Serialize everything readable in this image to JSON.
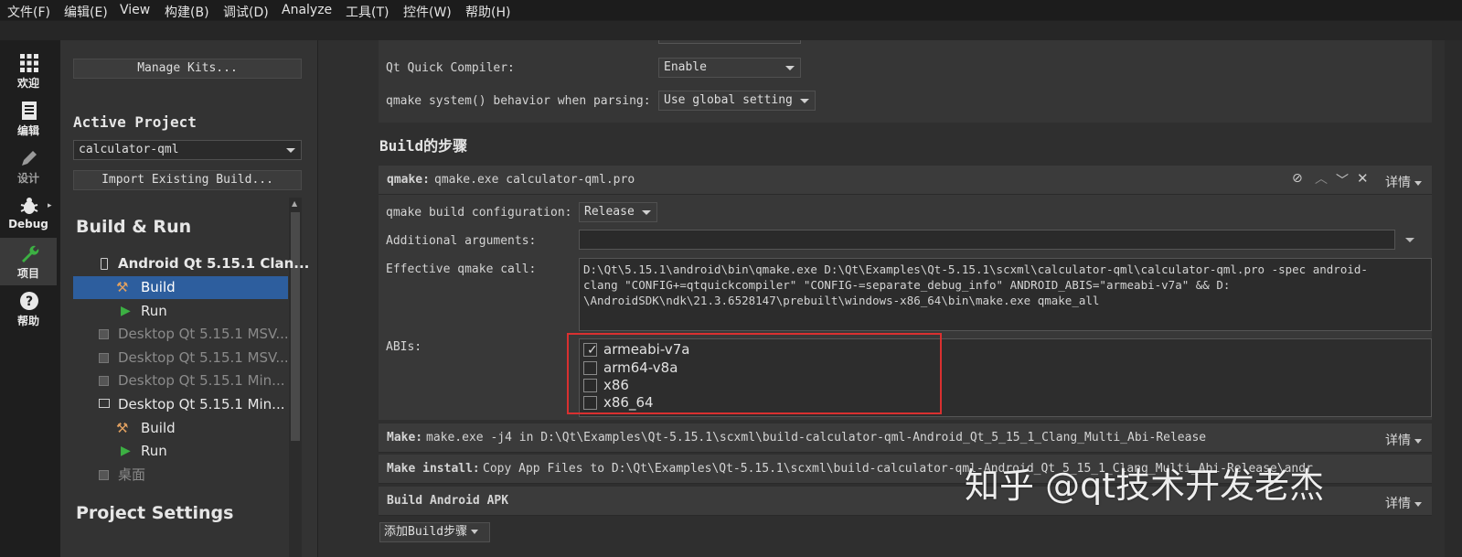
{
  "menu": [
    "文件(F)",
    "编辑(E)",
    "View",
    "构建(B)",
    "调试(D)",
    "Analyze",
    "工具(T)",
    "控件(W)",
    "帮助(H)"
  ],
  "modes": [
    {
      "label": "欢迎",
      "icon": "grid-icon"
    },
    {
      "label": "编辑",
      "icon": "document-icon"
    },
    {
      "label": "设计",
      "icon": "pencil-icon"
    },
    {
      "label": "Debug",
      "icon": "bug-icon"
    },
    {
      "label": "项目",
      "icon": "wrench-icon"
    },
    {
      "label": "帮助",
      "icon": "help-icon"
    }
  ],
  "left": {
    "manage_kits": "Manage Kits...",
    "active_project_heading": "Active Project",
    "active_project": "calculator-qml",
    "import_build": "Import Existing Build...",
    "build_run_heading": "Build & Run",
    "kits": [
      {
        "label": "Android Qt 5.15.1 Clan...",
        "build": "Build",
        "run": "Run"
      },
      {
        "label": "Desktop Qt 5.15.1 MSV..."
      },
      {
        "label": "Desktop Qt 5.15.1 MSV..."
      },
      {
        "label": "Desktop Qt 5.15.1 Min..."
      },
      {
        "label": "Desktop Qt 5.15.1 Min...",
        "build": "Build",
        "run": "Run"
      },
      {
        "label": "桌面"
      }
    ],
    "project_settings_heading": "Project Settings"
  },
  "main": {
    "qt_quick_compiler_label": "Qt Quick Compiler:",
    "qt_quick_compiler_value": "Enable",
    "qmake_system_label": "qmake system() behavior when parsing:",
    "qmake_system_value": "Use global setting",
    "build_steps_heading": "Build的步骤",
    "qmake_step": {
      "title_bold": "qmake:",
      "title_rest": " qmake.exe calculator-qml.pro",
      "details": "详情",
      "build_config_label": "qmake build configuration:",
      "build_config_value": "Release",
      "additional_args_label": "Additional arguments:",
      "additional_args_value": "",
      "effective_call_label": "Effective qmake call:",
      "effective_call_lines": [
        "D:\\Qt\\5.15.1\\android\\bin\\qmake.exe D:\\Qt\\Examples\\Qt-5.15.1\\scxml\\calculator-qml\\calculator-qml.pro -spec android-",
        "clang \"CONFIG+=qtquickcompiler\" \"CONFIG-=separate_debug_info\" ANDROID_ABIS=\"armeabi-v7a\" && D:",
        "\\AndroidSDK\\ndk\\21.3.6528147\\prebuilt\\windows-x86_64\\bin\\make.exe qmake_all"
      ],
      "abis_label": "ABIs:",
      "abis": [
        {
          "name": "armeabi-v7a",
          "checked": true
        },
        {
          "name": "arm64-v8a",
          "checked": false
        },
        {
          "name": "x86",
          "checked": false
        },
        {
          "name": "x86_64",
          "checked": false
        }
      ]
    },
    "make_step": {
      "title_bold": "Make:",
      "title_rest": " make.exe -j4 in D:\\Qt\\Examples\\Qt-5.15.1\\scxml\\build-calculator-qml-Android_Qt_5_15_1_Clang_Multi_Abi-Release",
      "details": "详情"
    },
    "make_install_step": {
      "title_bold": "Make install:",
      "title_rest": " Copy App Files to D:\\Qt\\Examples\\Qt-5.15.1\\scxml\\build-calculator-qml-Android_Qt_5_15_1_Clang_Multi_Abi-Release\\andr"
    },
    "build_apk_step": {
      "title_bold": "Build Android APK",
      "details": "详情"
    },
    "add_build_step": "添加Build步骤"
  },
  "watermark": "知乎 @qt技术开发老杰",
  "colors": {
    "selection": "#2d5e9e",
    "highlight_box": "#d93030",
    "run_green": "#3cb043",
    "build_orange": "#e0a060"
  }
}
